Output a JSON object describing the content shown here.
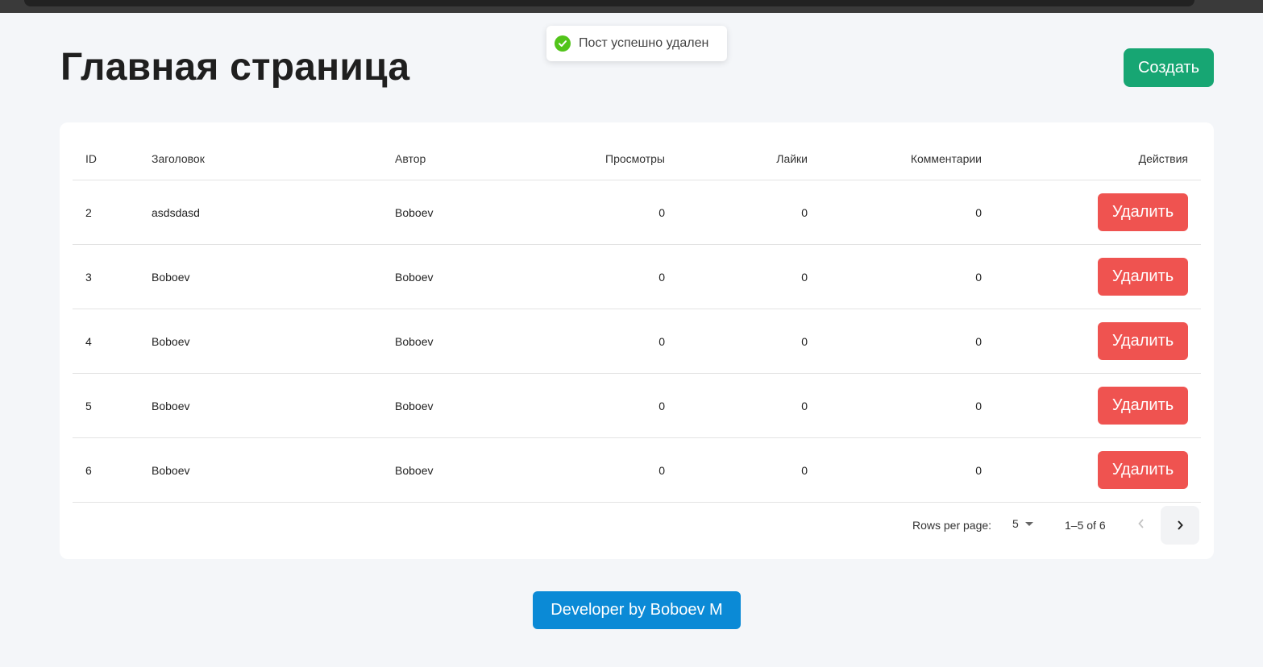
{
  "toast": {
    "message": "Пост успешно удален",
    "icon": "check-circle-icon"
  },
  "header": {
    "title": "Главная страница",
    "create_label": "Создать"
  },
  "table": {
    "columns": [
      "ID",
      "Заголовок",
      "Автор",
      "Просмотры",
      "Лайки",
      "Комментарии",
      "Действия"
    ],
    "rows": [
      {
        "id": "2",
        "title": "asdsdasd",
        "author": "Boboev",
        "views": "0",
        "likes": "0",
        "comments": "0",
        "action": "Удалить"
      },
      {
        "id": "3",
        "title": "Boboev",
        "author": "Boboev",
        "views": "0",
        "likes": "0",
        "comments": "0",
        "action": "Удалить"
      },
      {
        "id": "4",
        "title": "Boboev",
        "author": "Boboev",
        "views": "0",
        "likes": "0",
        "comments": "0",
        "action": "Удалить"
      },
      {
        "id": "5",
        "title": "Boboev",
        "author": "Boboev",
        "views": "0",
        "likes": "0",
        "comments": "0",
        "action": "Удалить"
      },
      {
        "id": "6",
        "title": "Boboev",
        "author": "Boboev",
        "views": "0",
        "likes": "0",
        "comments": "0",
        "action": "Удалить"
      }
    ]
  },
  "pagination": {
    "rows_per_page_label": "Rows per page:",
    "rows_per_page_value": "5",
    "range": "1–5 of 6"
  },
  "footer": {
    "developer_label": "Developer by Boboev M"
  },
  "colors": {
    "create": "#17a673",
    "delete": "#ef5350",
    "developer": "#0b8ad6",
    "success": "#52c41a",
    "background": "#f4f6f9"
  }
}
